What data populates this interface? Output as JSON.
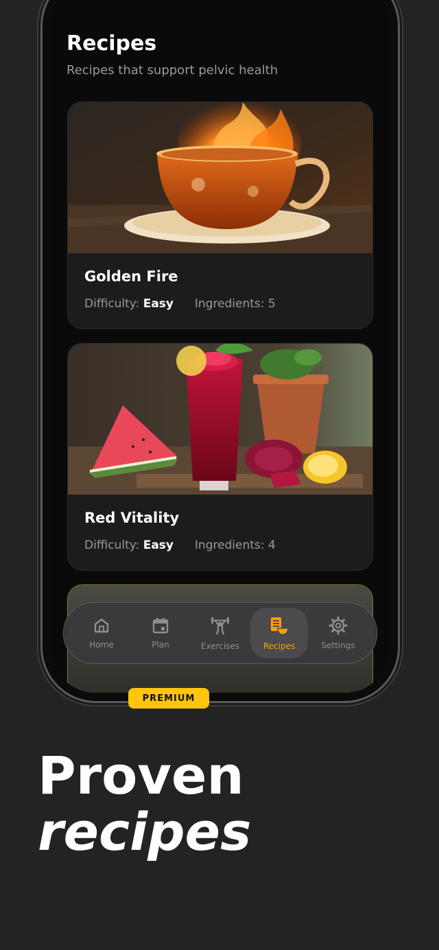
{
  "screen": {
    "title": "Recipes",
    "subtitle": "Recipes that support pelvic health"
  },
  "recipes": [
    {
      "name": "Golden Fire",
      "difficulty_label": "Difficulty:",
      "difficulty": "Easy",
      "ingredients_label": "Ingredients: 5"
    },
    {
      "name": "Red Vitality",
      "difficulty_label": "Difficulty:",
      "difficulty": "Easy",
      "ingredients_label": "Ingredients: 4"
    }
  ],
  "premium_badge": "PREMIUM",
  "tabbar": {
    "items": [
      {
        "label": "Home",
        "icon": "home-icon"
      },
      {
        "label": "Plan",
        "icon": "calendar-icon"
      },
      {
        "label": "Exercises",
        "icon": "weightlifting-icon"
      },
      {
        "label": "Recipes",
        "icon": "recipes-icon",
        "active": true
      },
      {
        "label": "Settings",
        "icon": "gear-icon"
      }
    ]
  },
  "headline": {
    "line1": "Proven",
    "line2": "recipes"
  },
  "colors": {
    "background": "#232323",
    "accent": "#ff9f0a",
    "premium": "#ffc50c",
    "card": "#1c1c1e"
  }
}
